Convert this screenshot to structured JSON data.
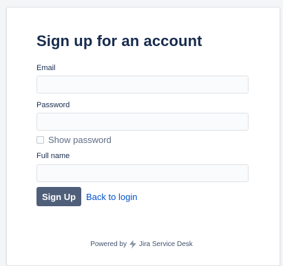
{
  "form": {
    "title": "Sign up for an account",
    "email_label": "Email",
    "email_value": "",
    "password_label": "Password",
    "password_value": "",
    "show_password_label": "Show password",
    "show_password_checked": false,
    "fullname_label": "Full name",
    "fullname_value": "",
    "signup_label": "Sign Up",
    "back_label": "Back to login"
  },
  "footer": {
    "powered_by": "Powered by",
    "product": "Jira Service Desk",
    "logo_icon": "jira-service-desk-logo-icon"
  },
  "colors": {
    "button": "#505f79",
    "link": "#0052cc",
    "title": "#172b4d",
    "logo": "#8993a4"
  }
}
